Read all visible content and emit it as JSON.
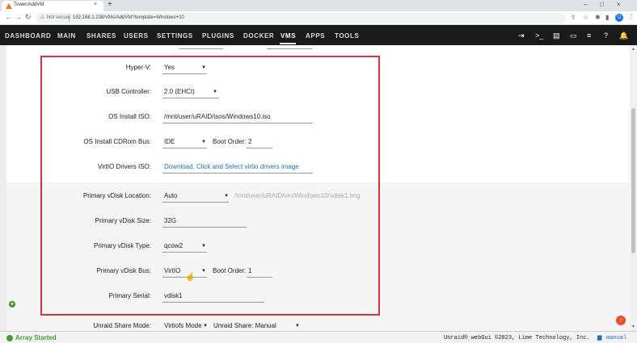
{
  "browser": {
    "tab_title": "Tower/AddVM",
    "tab_close": "×",
    "new_tab": "+",
    "not_secure": "Not secure",
    "url": "192.168.1.238/VMs/AddVM?template=Windows+10",
    "profile_initial": "U",
    "win_min": "–",
    "win_max": "□",
    "win_close": "×"
  },
  "nav": {
    "items": [
      "DASHBOARD",
      "MAIN",
      "SHARES",
      "USERS",
      "SETTINGS",
      "PLUGINS",
      "DOCKER",
      "VMS",
      "APPS",
      "TOOLS"
    ],
    "active": "VMS"
  },
  "form": {
    "hyperv": {
      "label": "Hyper-V:",
      "value": "Yes"
    },
    "usb": {
      "label": "USB Controller:",
      "value": "2.0 (EHCI)"
    },
    "os_iso": {
      "label": "OS Install ISO:",
      "value": "/mnt/user/uRAID/isos/Windows10.iso"
    },
    "os_bus": {
      "label": "OS Install CDRom Bus:",
      "value": "IDE",
      "boot_label": "Boot Order:",
      "boot_value": "2"
    },
    "virtio": {
      "label": "VirtIO Drivers ISO:",
      "value": "Download, Click and Select virtio drivers image"
    },
    "vdisk_loc": {
      "label": "Primary vDisk Location:",
      "value": "Auto",
      "path": "/mnt/user/uRAID/vm/Windows10/vdisk1.img"
    },
    "vdisk_size": {
      "label": "Primary vDisk Size:",
      "value": "32G"
    },
    "vdisk_type": {
      "label": "Primary vDisk Type:",
      "value": "qcow2"
    },
    "vdisk_bus": {
      "label": "Primary vDisk Bus:",
      "value": "VirtIO",
      "boot_label": "Boot Order:",
      "boot_value": "1"
    },
    "serial": {
      "label": "Primary Serial:",
      "value": "vdisk1"
    },
    "share_mode": {
      "label": "Unraid Share Mode:",
      "value": "Virtiofs Mode",
      "share_value": "Unraid Share: Manual"
    }
  },
  "footer": {
    "array_status": "Array Started",
    "copyright": "Unraid® webGui ©2023, Lime Technology, Inc.",
    "manual": "manual"
  },
  "colors": {
    "highlight": "#d8353b",
    "array_green": "#4a9c2b",
    "link_blue": "#1e6fb8",
    "nav_bg": "#1a1a1a",
    "bell_orange": "#f15a2c"
  }
}
